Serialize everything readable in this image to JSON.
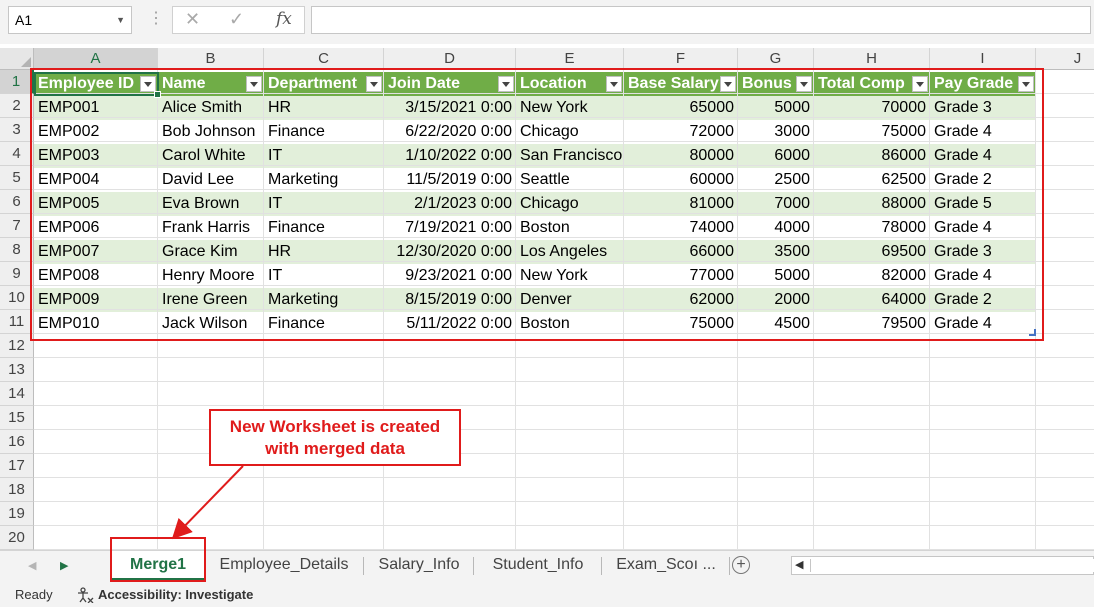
{
  "formula_bar": {
    "name_box": "A1",
    "cancel_glyph": "✕",
    "enter_glyph": "✓",
    "fx_label": "fx",
    "formula": ""
  },
  "columns": [
    "A",
    "B",
    "C",
    "D",
    "E",
    "F",
    "G",
    "H",
    "I",
    "J"
  ],
  "rows": [
    "1",
    "2",
    "3",
    "4",
    "5",
    "6",
    "7",
    "8",
    "9",
    "10",
    "11",
    "12",
    "13",
    "14",
    "15",
    "16",
    "17",
    "18",
    "19",
    "20"
  ],
  "table": {
    "headers": [
      "Employee ID",
      "Name",
      "Department",
      "Join Date",
      "Location",
      "Base Salary",
      "Bonus",
      "Total Comp",
      "Pay Grade"
    ],
    "rows": [
      [
        "EMP001",
        "Alice Smith",
        "HR",
        "3/15/2021 0:00",
        "New York",
        "65000",
        "5000",
        "70000",
        "Grade 3"
      ],
      [
        "EMP002",
        "Bob Johnson",
        "Finance",
        "6/22/2020 0:00",
        "Chicago",
        "72000",
        "3000",
        "75000",
        "Grade 4"
      ],
      [
        "EMP003",
        "Carol White",
        "IT",
        "1/10/2022 0:00",
        "San Francisco",
        "80000",
        "6000",
        "86000",
        "Grade 4"
      ],
      [
        "EMP004",
        "David Lee",
        "Marketing",
        "11/5/2019 0:00",
        "Seattle",
        "60000",
        "2500",
        "62500",
        "Grade 2"
      ],
      [
        "EMP005",
        "Eva Brown",
        "IT",
        "2/1/2023 0:00",
        "Chicago",
        "81000",
        "7000",
        "88000",
        "Grade 5"
      ],
      [
        "EMP006",
        "Frank Harris",
        "Finance",
        "7/19/2021 0:00",
        "Boston",
        "74000",
        "4000",
        "78000",
        "Grade 4"
      ],
      [
        "EMP007",
        "Grace Kim",
        "HR",
        "12/30/2020 0:00",
        "Los Angeles",
        "66000",
        "3500",
        "69500",
        "Grade 3"
      ],
      [
        "EMP008",
        "Henry Moore",
        "IT",
        "9/23/2021 0:00",
        "New York",
        "77000",
        "5000",
        "82000",
        "Grade 4"
      ],
      [
        "EMP009",
        "Irene Green",
        "Marketing",
        "8/15/2019 0:00",
        "Denver",
        "62000",
        "2000",
        "64000",
        "Grade 2"
      ],
      [
        "EMP010",
        "Jack Wilson",
        "Finance",
        "5/11/2022 0:00",
        "Boston",
        "75000",
        "4500",
        "79500",
        "Grade 4"
      ]
    ]
  },
  "annotation": {
    "line1": "New Worksheet is created",
    "line2": "with merged data"
  },
  "sheet_tabs": [
    {
      "label": "Merge1",
      "active": true
    },
    {
      "label": "Employee_Details",
      "active": false
    },
    {
      "label": "Salary_Info",
      "active": false
    },
    {
      "label": "Student_Info",
      "active": false
    },
    {
      "label": "Exam_Scoı ...",
      "active": false
    }
  ],
  "add_sheet_glyph": "+",
  "status": {
    "ready": "Ready",
    "accessibility": "Accessibility: Investigate"
  },
  "colors": {
    "accent": "#217346",
    "table_header": "#70ad47",
    "band": "#e2efda",
    "annotation": "#e01b1b"
  }
}
